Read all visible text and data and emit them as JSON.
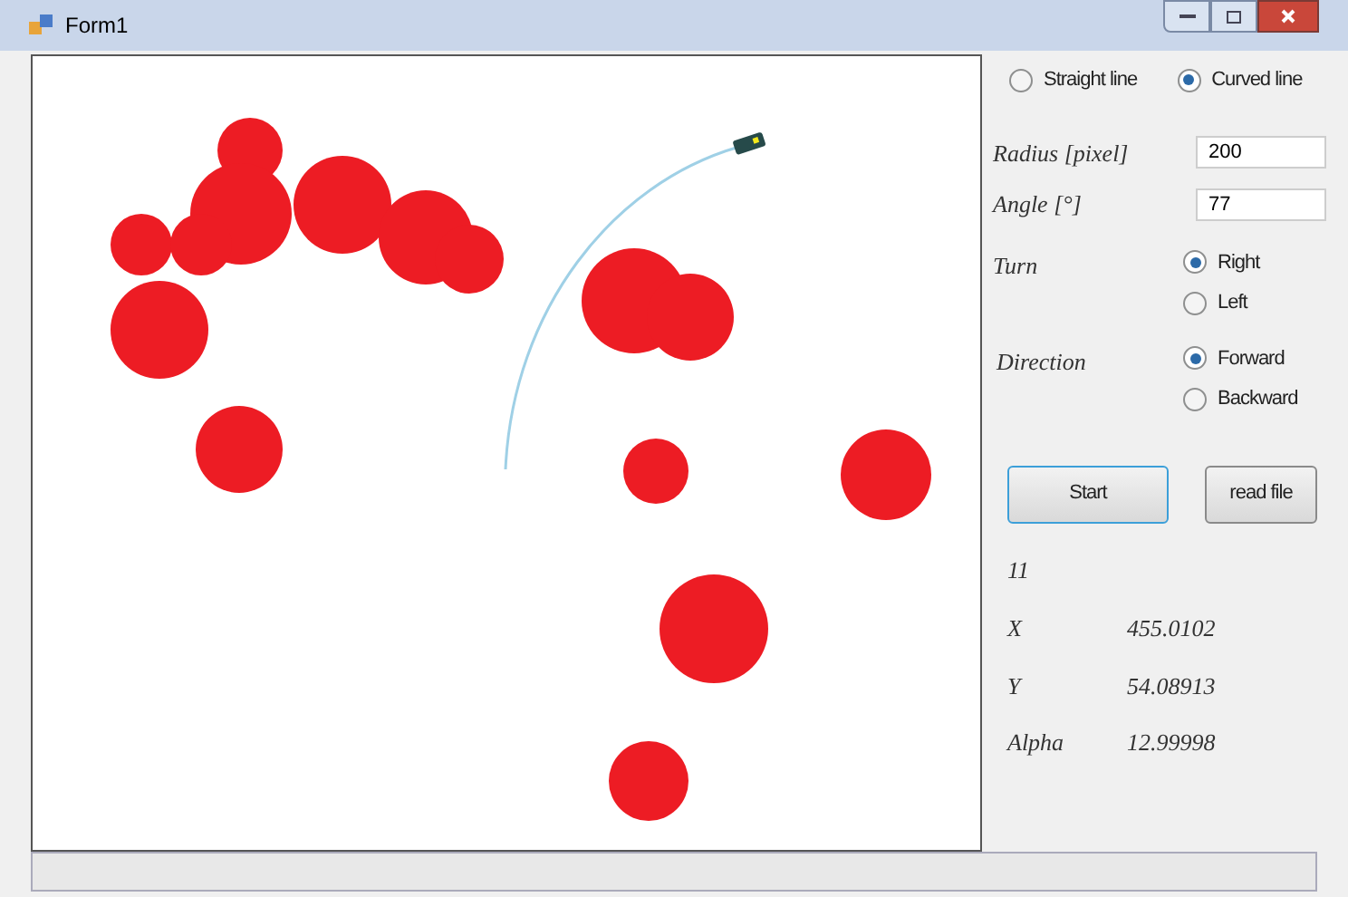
{
  "window": {
    "title": "Form1"
  },
  "mode": [
    {
      "label": "Straight line",
      "selected": false
    },
    {
      "label": "Curved line",
      "selected": true
    }
  ],
  "fields": [
    {
      "label": "Radius [pixel]",
      "value": "200"
    },
    {
      "label": "Angle [°]",
      "value": "77"
    }
  ],
  "turn": {
    "label": "Turn",
    "options": [
      {
        "label": "Right",
        "selected": true
      },
      {
        "label": "Left",
        "selected": false
      }
    ]
  },
  "direction": {
    "label": "Direction",
    "options": [
      {
        "label": "Forward",
        "selected": true
      },
      {
        "label": "Backward",
        "selected": false
      }
    ]
  },
  "buttons": [
    {
      "label": "Start",
      "focused": true
    },
    {
      "label": "read file",
      "focused": false
    }
  ],
  "count": "11",
  "readouts": [
    {
      "label": "X",
      "value": "455.0102"
    },
    {
      "label": "Y",
      "value": "54.08913"
    },
    {
      "label": "Alpha",
      "value": "12.99998"
    }
  ]
}
